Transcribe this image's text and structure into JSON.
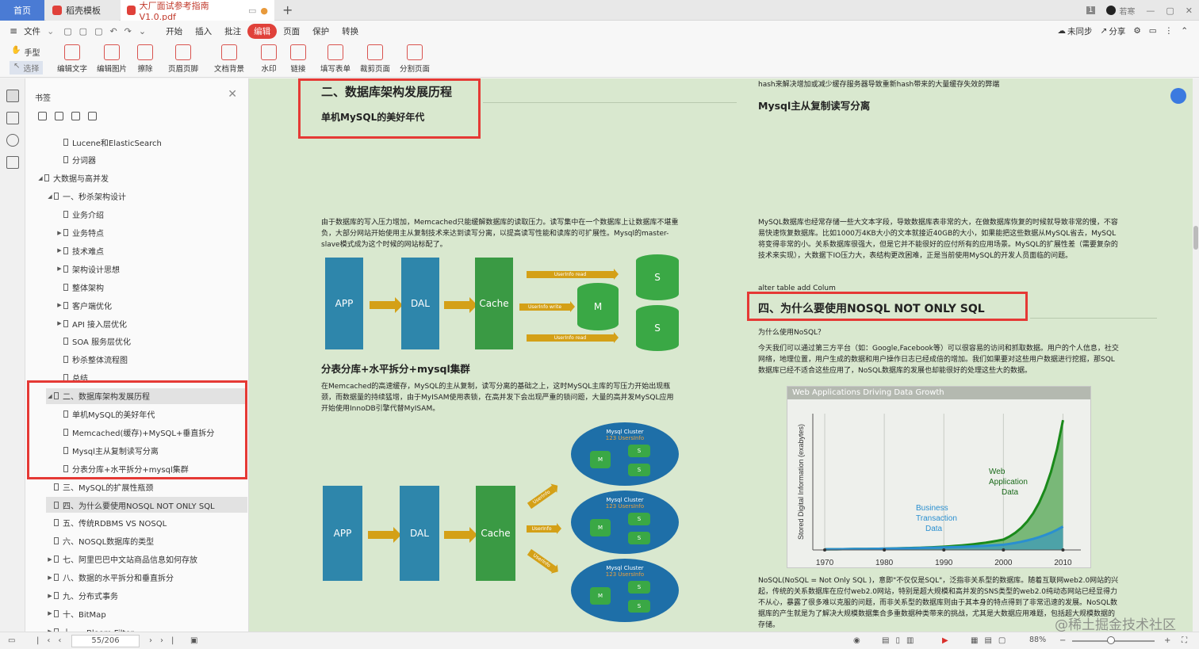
{
  "titlebar": {
    "tab_home": "首页",
    "tab_template": "稻壳模板",
    "tab_pdf": "大厂面试参考指南V1.0.pdf",
    "page_badge": "1",
    "user": "若寒"
  },
  "menubar": {
    "items": [
      "文件",
      "开始",
      "插入",
      "批注",
      "编辑",
      "页面",
      "保护",
      "转换"
    ],
    "active": "编辑",
    "sync": "未同步",
    "share": "分享"
  },
  "toolbar": {
    "hand": "手型",
    "select": "选择",
    "tools": [
      "编辑文字",
      "编辑图片",
      "擦除",
      "页眉页脚",
      "文档背景",
      "水印",
      "链接",
      "填写表单",
      "裁剪页面",
      "分割页面"
    ]
  },
  "bookmarks": {
    "title": "书签",
    "items": [
      {
        "label": "Lucene和ElasticSearch",
        "indent": 2,
        "arrow": ""
      },
      {
        "label": "分词器",
        "indent": 2,
        "arrow": ""
      },
      {
        "label": "大数据与高并发",
        "indent": 0,
        "arrow": "◢"
      },
      {
        "label": "一、秒杀架构设计",
        "indent": 1,
        "arrow": "◢"
      },
      {
        "label": "业务介绍",
        "indent": 2,
        "arrow": ""
      },
      {
        "label": "业务特点",
        "indent": 2,
        "arrow": "▶"
      },
      {
        "label": "技术难点",
        "indent": 2,
        "arrow": "▶"
      },
      {
        "label": "架构设计思想",
        "indent": 2,
        "arrow": "▶"
      },
      {
        "label": "整体架构",
        "indent": 2,
        "arrow": ""
      },
      {
        "label": "客户端优化",
        "indent": 2,
        "arrow": "▶"
      },
      {
        "label": "API 接入层优化",
        "indent": 2,
        "arrow": "▶"
      },
      {
        "label": "SOA 服务层优化",
        "indent": 2,
        "arrow": ""
      },
      {
        "label": "秒杀整体流程图",
        "indent": 2,
        "arrow": ""
      },
      {
        "label": "总结",
        "indent": 2,
        "arrow": ""
      },
      {
        "label": "二、数据库架构发展历程",
        "indent": 1,
        "arrow": "◢",
        "selected": true
      },
      {
        "label": "单机MySQL的美好年代",
        "indent": 2,
        "arrow": ""
      },
      {
        "label": "Memcached(缓存)+MySQL+垂直拆分",
        "indent": 2,
        "arrow": ""
      },
      {
        "label": "Mysql主从复制读写分离",
        "indent": 2,
        "arrow": ""
      },
      {
        "label": "分表分库+水平拆分+mysql集群",
        "indent": 2,
        "arrow": ""
      },
      {
        "label": "三、MySQL的扩展性瓶颈",
        "indent": 1,
        "arrow": ""
      },
      {
        "label": "四、为什么要使用NOSQL   NOT ONLY SQL",
        "indent": 1,
        "arrow": "",
        "selected": true
      },
      {
        "label": "五、传统RDBMS VS NOSQL",
        "indent": 1,
        "arrow": ""
      },
      {
        "label": "六、NOSQL数据库的类型",
        "indent": 1,
        "arrow": ""
      },
      {
        "label": "七、阿里巴巴中文站商品信息如何存放",
        "indent": 1,
        "arrow": "▶"
      },
      {
        "label": "八、数据的水平拆分和垂直拆分",
        "indent": 1,
        "arrow": "▶"
      },
      {
        "label": "九、分布式事务",
        "indent": 1,
        "arrow": "▶"
      },
      {
        "label": "十、BitMap",
        "indent": 1,
        "arrow": "▶"
      },
      {
        "label": "十一、Bloom Filter",
        "indent": 1,
        "arrow": "▶"
      }
    ]
  },
  "left": {
    "h1": "二、数据库架构发展历程",
    "h2": "单机MySQL的美好年代",
    "p1": "由于数据库的写入压力增加，Memcached只能缓解数据库的读取压力。读写集中在一个数据库上让数据库不堪重负，大部分网站开始使用主从复制技术来达到读写分离，以提高读写性能和读库的可扩展性。Mysql的master-slave模式成为这个时候的网站标配了。",
    "d1": {
      "app": "APP",
      "dal": "DAL",
      "cache": "Cache",
      "m": "M",
      "s1": "S",
      "s2": "S",
      "r1": "UserInfo  read",
      "w": "UserInfo  write",
      "r2": "UserInfo  read"
    },
    "h3": "分表分库+水平拆分+mysql集群",
    "p2": "在Memcached的高速缓存，MySQL的主从复制，读写分离的基础之上，这时MySQL主库的写压力开始出现瓶颈，而数据量的持续猛增，由于MyISAM使用表锁，在高并发下会出现严重的锁问题，大量的高并发MySQL应用开始使用InnoDB引擎代替MyISAM。",
    "d2": {
      "app": "APP",
      "dal": "DAL",
      "cache": "Cache",
      "cluster": "Mysql Cluster",
      "sub": "123 UsersInfo",
      "arrow": "UserInfo",
      "m": "M",
      "s": "S"
    }
  },
  "right": {
    "top": "hash来解决增加或减少缓存服务器导致重新hash带来的大量缓存失效的弊端",
    "h1": "Mysql主从复制读写分离",
    "p1": "MySQL数据库也经常存储一些大文本字段，导致数据库表非常的大，在做数据库恢复的时候就导致非常的慢，不容易快速恢复数据库。比如1000万4KB大小的文本就接近40GB的大小，如果能把这些数据从MySQL省去，MySQL将变得非常的小。关系数据库很强大，但是它并不能很好的应付所有的应用场景。MySQL的扩展性差（需要复杂的技术来实现），大数据下IO压力大，表结构更改困难，正是当前使用MySQL的开发人员面临的问题。",
    "alter": "alter table add Colum",
    "h2": "四、为什么要使用NOSQL   NOT ONLY SQL",
    "q": "为什么使用NoSQL？",
    "p2": "今天我们可以通过第三方平台（如：Google,Facebook等）可以很容易的访问和抓取数据。用户的个人信息，社交网络，地理位置，用户生成的数据和用户操作日志已经成倍的增加。我们如果要对这些用户数据进行挖掘，那SQL数据库已经不适合这些应用了，NoSQL数据库的发展也却能很好的处理这些大的数据。",
    "p3": "NoSQL(NoSQL = Not Only SQL )，意即\"不仅仅是SQL\"，泛指非关系型的数据库。随着互联网web2.0网站的兴起，传统的关系数据库在应付web2.0网站，特别是超大规模和高并发的SNS类型的web2.0纯动态网站已经显得力不从心，暴露了很多难以克服的问题，而非关系型的数据库则由于其本身的特点得到了非常迅速的发展。NoSQL数据库的产生就是为了解决大规模数据集合多重数据种类带来的挑战，尤其是大数据应用难题，包括超大规模数据的存储。"
  },
  "chart_data": {
    "type": "area",
    "title": "Web Applications Driving Data Growth",
    "ylabel": "Stored Digital Information (exabytes)",
    "xlabel": "",
    "x": [
      1970,
      1980,
      1990,
      2000,
      2010
    ],
    "series": [
      {
        "name": "Business Transaction Data",
        "color": "#2a8fd0",
        "values": [
          0.5,
          1,
          2,
          4,
          18
        ]
      },
      {
        "name": "Web Application Data",
        "color": "#1a8a1a",
        "values": [
          0.5,
          1,
          2.5,
          8,
          100
        ]
      }
    ]
  },
  "status": {
    "page": "55/206",
    "zoom": "88%"
  },
  "watermark": "@稀土掘金技术社区"
}
